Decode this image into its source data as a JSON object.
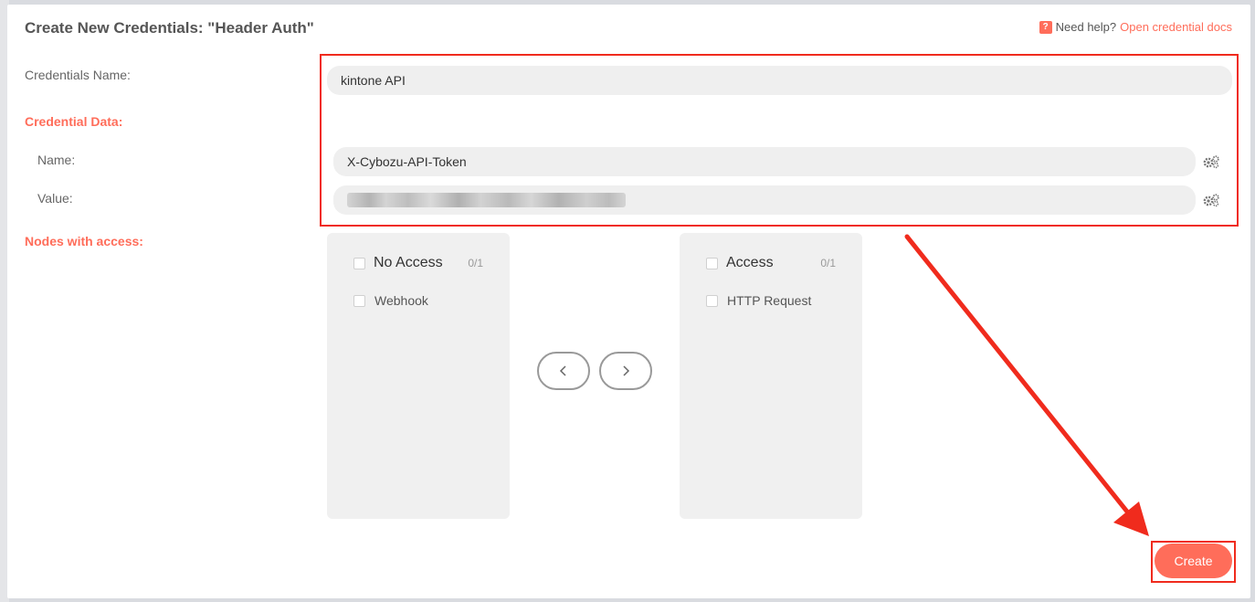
{
  "dialog": {
    "title": "Create New Credentials: \"Header Auth\"",
    "help_icon": "?",
    "help_text": "Need help?",
    "help_link": "Open credential docs"
  },
  "form": {
    "credentials_name_label": "Credentials Name:",
    "credentials_name_value": "kintone API",
    "credential_data_label": "Credential Data:",
    "name_label": "Name:",
    "name_value": "X-Cybozu-API-Token",
    "value_label": "Value:",
    "nodes_access_label": "Nodes with access:"
  },
  "transfer": {
    "left": {
      "title": "No Access",
      "count": "0/1",
      "items": [
        "Webhook"
      ]
    },
    "right": {
      "title": "Access",
      "count": "0/1",
      "items": [
        "HTTP Request"
      ]
    },
    "move_left_icon": "chevron-left-icon",
    "move_right_icon": "chevron-right-icon"
  },
  "actions": {
    "create_label": "Create"
  },
  "colors": {
    "accent": "#ff6d5a",
    "annotation": "#f02b1d"
  }
}
